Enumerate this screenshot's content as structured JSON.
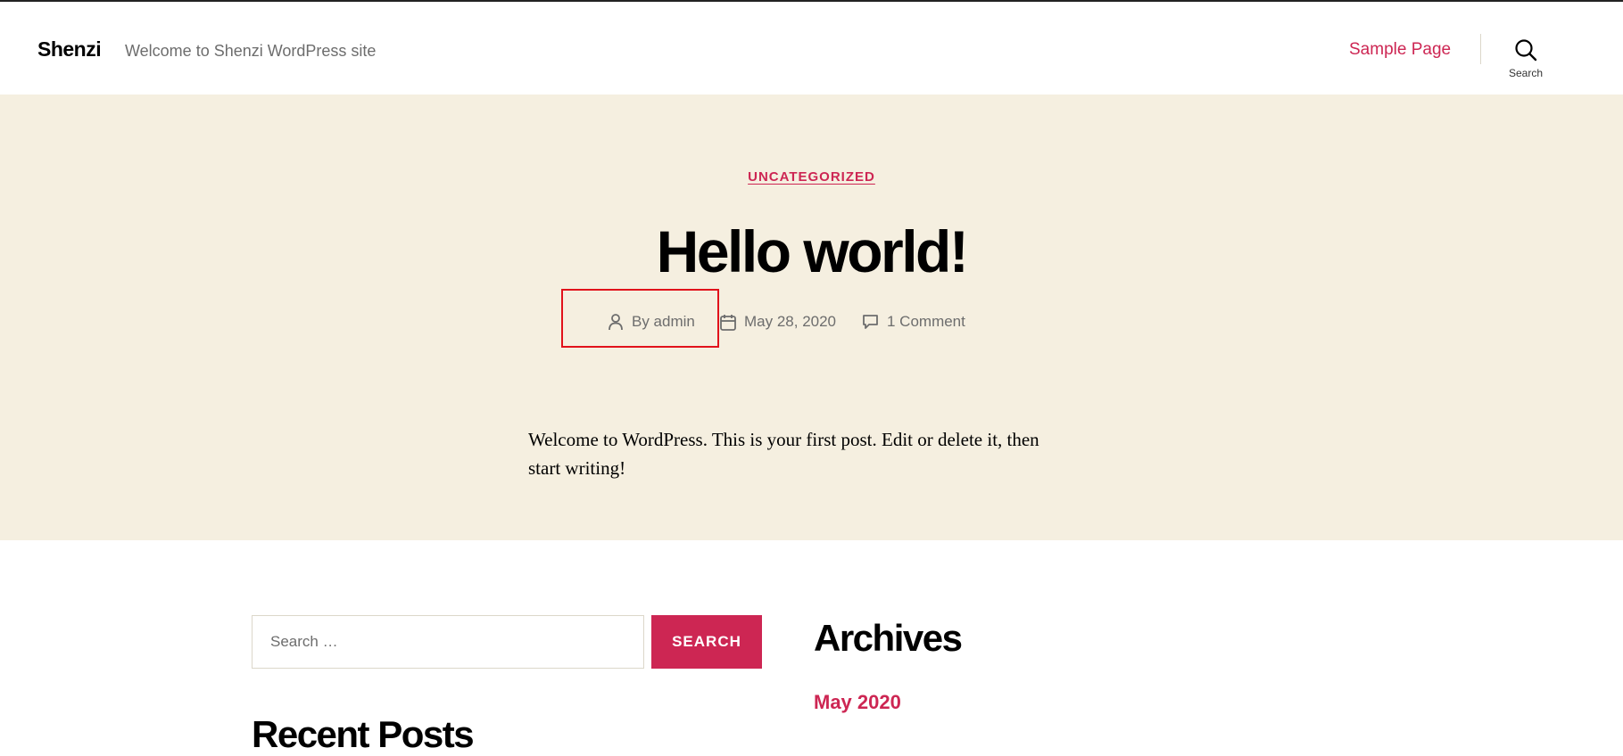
{
  "header": {
    "site_title": "Shenzi",
    "site_description": "Welcome to Shenzi WordPress site",
    "nav": [
      {
        "label": "Sample Page"
      }
    ],
    "search_toggle_label": "Search"
  },
  "post": {
    "category": "UNCATEGORIZED",
    "title": "Hello world!",
    "meta": {
      "author": "By admin",
      "date": "May 28, 2020",
      "comments": "1 Comment"
    },
    "excerpt": "Welcome to WordPress. This is your first post. Edit or delete it, then start writing!"
  },
  "widgets": {
    "search": {
      "placeholder": "Search …",
      "button_label": "SEARCH"
    },
    "recent_posts_title": "Recent Posts",
    "archives": {
      "title": "Archives",
      "items": [
        {
          "label": "May 2020"
        }
      ]
    }
  },
  "colors": {
    "accent": "#cd2653",
    "hero_background": "#f5efe0",
    "highlight_box": "#e1121b"
  },
  "icons": {
    "search": "search-icon",
    "author": "user-icon",
    "date": "calendar-icon",
    "comments": "comment-icon"
  }
}
